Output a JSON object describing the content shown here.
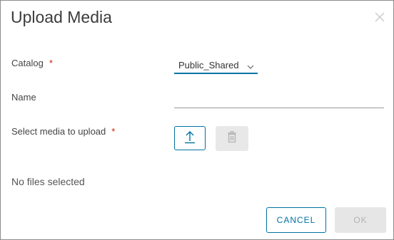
{
  "dialog": {
    "title": "Upload Media",
    "close_icon": "close-icon"
  },
  "form": {
    "catalog": {
      "label": "Catalog",
      "required_mark": "*",
      "selected_value": "Public_Shared",
      "chevron_icon": "chevron-down-icon"
    },
    "name": {
      "label": "Name",
      "value": "",
      "placeholder": ""
    },
    "media": {
      "label": "Select media to upload",
      "required_mark": "*",
      "upload_icon": "upload-icon",
      "delete_icon": "trash-icon"
    },
    "status_text": "No files selected"
  },
  "footer": {
    "cancel_label": "CANCEL",
    "ok_label": "OK"
  },
  "colors": {
    "accent": "#0072a3",
    "required": "#c92100",
    "disabled_bg": "#e6e6e6",
    "disabled_text": "#b3b3b3"
  }
}
